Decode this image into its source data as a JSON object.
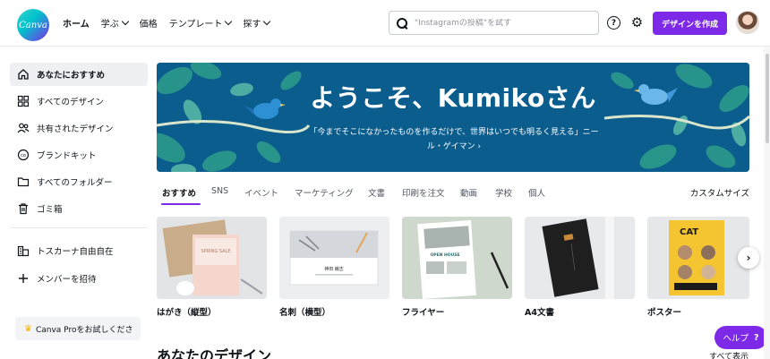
{
  "header": {
    "logo_text": "Canva",
    "nav": [
      {
        "label": "ホーム",
        "dropdown": false,
        "active": true
      },
      {
        "label": "学ぶ",
        "dropdown": true,
        "active": false
      },
      {
        "label": "価格",
        "dropdown": false,
        "active": false
      },
      {
        "label": "テンプレート",
        "dropdown": true,
        "active": false
      },
      {
        "label": "探す",
        "dropdown": true,
        "active": false
      }
    ],
    "search_placeholder": "\"Instagramの投稿\"を試す",
    "help_icon_text": "?",
    "create_label": "デザインを作成",
    "accent_color": "#7d2ae8"
  },
  "sidebar": {
    "items": [
      {
        "label": "あなたにおすすめ",
        "icon": "home-icon",
        "active": true
      },
      {
        "label": "すべてのデザイン",
        "icon": "grid-icon",
        "active": false
      },
      {
        "label": "共有されたデザイン",
        "icon": "people-icon",
        "active": false
      },
      {
        "label": "ブランドキット",
        "icon": "brand-kit-icon",
        "active": false
      },
      {
        "label": "すべてのフォルダー",
        "icon": "folder-icon",
        "active": false
      },
      {
        "label": "ゴミ箱",
        "icon": "trash-icon",
        "active": false
      },
      {
        "label": "トスカーナ自由自在",
        "icon": "team-icon",
        "active": false
      },
      {
        "label": "メンバーを招待",
        "icon": "plus-icon",
        "active": false
      }
    ],
    "pro_label": "Canva Proをお試しくださ"
  },
  "hero": {
    "title": "ようこそ、Kumikoさん",
    "quote": "「今までそこになかったものを作るだけで、世界はいつでも明るく見える」ニール・ゲイマン ›"
  },
  "tabs": {
    "items": [
      "おすすめ",
      "SNS",
      "イベント",
      "マーケティング",
      "文書",
      "印刷を注文",
      "動画",
      "学校",
      "個人"
    ],
    "active_index": 0,
    "custom_size": "カスタムサイズ"
  },
  "cards": [
    {
      "label": "はがき（縦型）",
      "thumb_text": "SPRING SALE"
    },
    {
      "label": "名刺（横型）",
      "thumb_text": "神田 織志"
    },
    {
      "label": "フライヤー",
      "thumb_text": "OPEN HOUSE"
    },
    {
      "label": "A4文書",
      "thumb_text": ""
    },
    {
      "label": "ポスター",
      "thumb_text": "CAT"
    }
  ],
  "next_arrow": "›",
  "section_title": "あなたのデザイン",
  "show_all": "すべて表示",
  "help_button": {
    "label": "ヘルプ",
    "q": "?"
  }
}
